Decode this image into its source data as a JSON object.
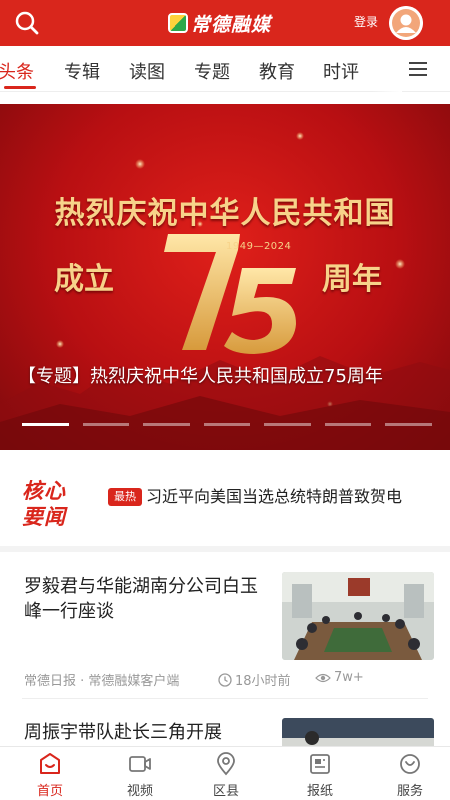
{
  "header": {
    "logo_text": "常德融媒",
    "login_label": "登录"
  },
  "tabs": [
    {
      "label": "头条",
      "active": true
    },
    {
      "label": "专辑"
    },
    {
      "label": "读图"
    },
    {
      "label": "专题"
    },
    {
      "label": "教育"
    },
    {
      "label": "时评"
    }
  ],
  "banner": {
    "headline_line1": "热烈庆祝中华人民共和国",
    "headline_left": "成立",
    "headline_number": "75",
    "headline_right": "周年",
    "years": "1949—2024",
    "caption": "【专题】热烈庆祝中华人民共和国成立75周年",
    "slide_count": 7,
    "active_slide": 1
  },
  "core_news": {
    "title_line1": "核心",
    "title_line2": "要闻",
    "badge": "最热",
    "text": "习近平向美国当选总统特朗普致贺电"
  },
  "articles": [
    {
      "title": "罗毅君与华能湖南分公司白玉峰一行座谈",
      "source": "常德日报 · 常德融媒客户端",
      "time": "18小时前",
      "views": "7w+"
    },
    {
      "title": "周振宇带队赴长三角开展"
    }
  ],
  "bottom_nav": [
    {
      "label": "首页",
      "icon": "home-icon",
      "active": true
    },
    {
      "label": "视频",
      "icon": "video-icon"
    },
    {
      "label": "区县",
      "icon": "location-icon"
    },
    {
      "label": "报纸",
      "icon": "newspaper-icon"
    },
    {
      "label": "服务",
      "icon": "service-icon"
    }
  ],
  "colors": {
    "brand_red": "#d9261c",
    "banner_gold": "#f7d38a"
  }
}
